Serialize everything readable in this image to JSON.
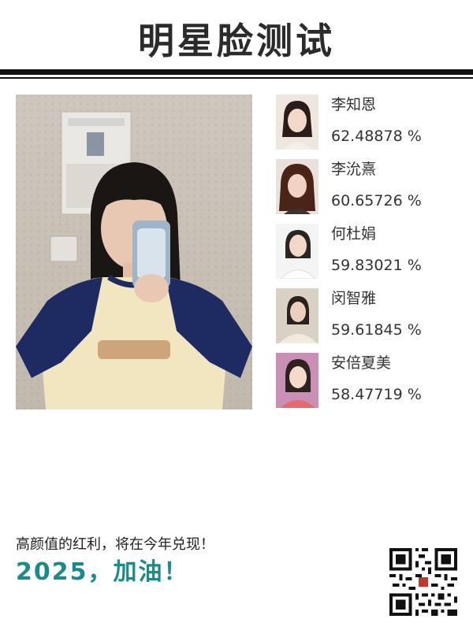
{
  "header": {
    "title": "明星脸测试"
  },
  "main_photo": {
    "icon": "selfie-photo"
  },
  "matches": [
    {
      "name": "李知恩",
      "score": "62.48878 %",
      "icon": "portrait-photo"
    },
    {
      "name": "李沇熹",
      "score": "60.65726 %",
      "icon": "portrait-photo"
    },
    {
      "name": "何杜娟",
      "score": "59.83021 %",
      "icon": "portrait-photo"
    },
    {
      "name": "闵智雅",
      "score": "59.61845 %",
      "icon": "portrait-photo"
    },
    {
      "name": "安倍夏美",
      "score": "58.47719 %",
      "icon": "portrait-photo"
    }
  ],
  "footer": {
    "tagline": "高颜值的红利，将在今年兑现！",
    "slogan": "2025，加油！",
    "qr_icon": "qr-code"
  },
  "colors": {
    "title": "#2b2b2b",
    "rule": "#111111",
    "slogan": "#1b8a8a",
    "text": "#333333"
  }
}
